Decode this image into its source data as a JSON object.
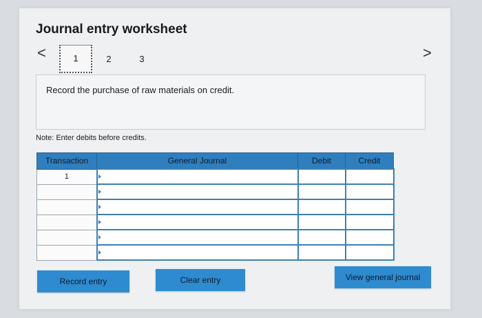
{
  "header": {
    "title": "Journal entry worksheet",
    "prev_label": "<",
    "next_label": ">"
  },
  "steps": [
    {
      "label": "1",
      "active": true
    },
    {
      "label": "2",
      "active": false
    },
    {
      "label": "3",
      "active": false
    }
  ],
  "instruction": "Record the purchase of raw materials on credit.",
  "note": "Note: Enter debits before credits.",
  "table": {
    "columns": [
      "Transaction",
      "General Journal",
      "Debit",
      "Credit"
    ],
    "rows": [
      {
        "transaction": "1"
      },
      {
        "transaction": ""
      },
      {
        "transaction": ""
      },
      {
        "transaction": ""
      },
      {
        "transaction": ""
      },
      {
        "transaction": ""
      }
    ]
  },
  "buttons": {
    "record": "Record entry",
    "clear": "Clear entry",
    "view": "View general journal"
  },
  "colors": {
    "accent": "#2f8bd0",
    "header": "#2f7fbf"
  }
}
